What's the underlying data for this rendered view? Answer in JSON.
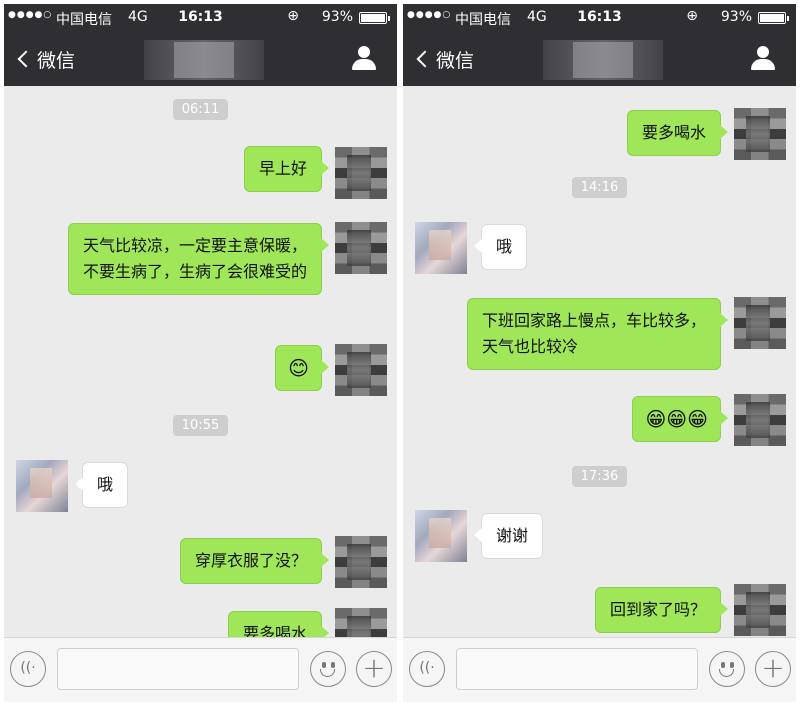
{
  "status_bar": {
    "signal": "●●●●○",
    "carrier": "中国电信",
    "network": "4G",
    "time": "16:13",
    "lock": "⊕",
    "battery": "93%"
  },
  "nav_bar": {
    "back_label": "微信"
  },
  "colors": {
    "header": "#2e2e33",
    "chat_bg": "#ebebeb",
    "sent_bubble": "#9fe659",
    "recv_bubble": "#ffffff",
    "timestamp_bg": "#cecece"
  },
  "left_screen": {
    "timestamps": [
      "06:11",
      "10:55"
    ],
    "messages": [
      {
        "from": "me",
        "text": "早上好"
      },
      {
        "from": "me",
        "text": "天气比较凉，一定要主意保暖，不要生病了，生病了会很难受的"
      },
      {
        "from": "me",
        "emoji": "😊"
      },
      {
        "from": "them",
        "text": "哦"
      },
      {
        "from": "me",
        "text": "穿厚衣服了没？"
      },
      {
        "from": "me",
        "text": "要多喝水"
      }
    ]
  },
  "right_screen": {
    "timestamps": [
      "14:16",
      "17:36"
    ],
    "messages": [
      {
        "from": "me",
        "text": "要多喝水"
      },
      {
        "from": "them",
        "text": "哦"
      },
      {
        "from": "me",
        "text": "下班回家路上慢点，车比较多，天气也比较冷"
      },
      {
        "from": "me",
        "emoji": "😁😁😁"
      },
      {
        "from": "them",
        "text": "谢谢"
      },
      {
        "from": "me",
        "text": "回到家了吗？"
      }
    ]
  },
  "input_bar": {
    "voice_icon": "voice-icon",
    "emoji_icon": "emoji-icon",
    "more_icon": "plus-icon",
    "plus": "+",
    "voice": "((·"
  }
}
